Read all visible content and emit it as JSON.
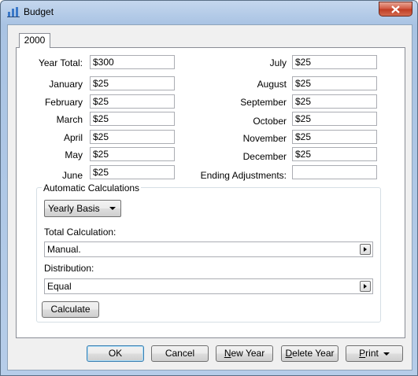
{
  "window": {
    "title": "Budget"
  },
  "tab": {
    "label": "2000"
  },
  "year_total": {
    "label": "Year Total:",
    "value": "$300"
  },
  "months_left": [
    {
      "label": "January",
      "value": "$25"
    },
    {
      "label": "February",
      "value": "$25"
    },
    {
      "label": "March",
      "value": "$25"
    },
    {
      "label": "April",
      "value": "$25"
    },
    {
      "label": "May",
      "value": "$25"
    },
    {
      "label": "June",
      "value": "$25"
    }
  ],
  "months_right": [
    {
      "label": "July",
      "value": "$25"
    },
    {
      "label": "August",
      "value": "$25"
    },
    {
      "label": "September",
      "value": "$25"
    },
    {
      "label": "October",
      "value": "$25"
    },
    {
      "label": "November",
      "value": "$25"
    },
    {
      "label": "December",
      "value": "$25"
    }
  ],
  "ending_adjustments": {
    "label": "Ending Adjustments:",
    "value": ""
  },
  "auto_calc": {
    "title": "Automatic Calculations",
    "basis_selected": "Yearly Basis",
    "total_calc_label": "Total Calculation:",
    "total_calc_value": "Manual.",
    "distribution_label": "Distribution:",
    "distribution_value": "Equal",
    "calculate_label": "Calculate"
  },
  "buttons": {
    "ok": "OK",
    "cancel": "Cancel",
    "new_year": "New Year",
    "new_year_mnemonic": "N",
    "new_year_rest": "ew Year",
    "delete_year": "Delete Year",
    "delete_year_mnemonic": "D",
    "delete_year_rest": "elete Year",
    "print": "Print",
    "print_mnemonic": "P",
    "print_rest": "rint"
  },
  "colors": {
    "titlebar": "#b6cde9",
    "close_button": "#c94a33",
    "dialog_bg": "#f0f0f0",
    "default_button_border": "#3c7fb1"
  },
  "icons": {
    "app": "bar-chart-icon",
    "close": "close-icon",
    "dropdown": "chevron-down-icon",
    "expand": "triangle-right-icon"
  }
}
